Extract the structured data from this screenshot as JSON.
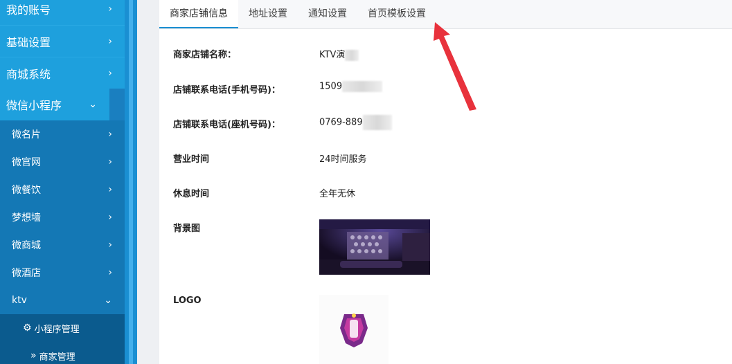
{
  "sidebar": {
    "top_items": [
      {
        "label": "我的账号",
        "chevron": "›"
      },
      {
        "label": "基础设置",
        "chevron": "›"
      },
      {
        "label": "商城系统",
        "chevron": "›"
      },
      {
        "label": "微信小程序",
        "chevron": "⌄"
      }
    ],
    "sub_items": [
      {
        "label": "微名片",
        "chevron": "›"
      },
      {
        "label": "微官网",
        "chevron": "›"
      },
      {
        "label": "微餐饮",
        "chevron": "›"
      },
      {
        "label": "梦想墙",
        "chevron": "›"
      },
      {
        "label": "微商城",
        "chevron": "›"
      },
      {
        "label": "微酒店",
        "chevron": "›"
      },
      {
        "label": "ktv",
        "chevron": "⌄"
      }
    ],
    "ktv_items": [
      {
        "label": "小程序管理",
        "icon": "gear-icon",
        "glyph": "⚙"
      },
      {
        "label": "商家管理",
        "icon": "double-chevron-right-icon",
        "glyph": "»"
      }
    ]
  },
  "tabs": [
    "商家店铺信息",
    "地址设置",
    "通知设置",
    "首页模板设置"
  ],
  "form": {
    "store_name_label": "商家店铺名称：",
    "store_name_value": "KTV演",
    "mobile_label": "店铺联系电话(手机号码)：",
    "mobile_value": "1509",
    "landline_label": "店铺联系电话(座机号码)：",
    "landline_value": "0769-889",
    "hours_label": "营业时间",
    "hours_value": "24时间服务",
    "closed_label": "休息时间",
    "closed_value": "全年无休",
    "background_label": "背景图",
    "logo_label": "LOGO"
  },
  "colors": {
    "sidebar": "#1a7fc0",
    "sidebar_active": "#1ea0dd",
    "accent": "#1a8fd2",
    "arrow": "#e8323c"
  }
}
